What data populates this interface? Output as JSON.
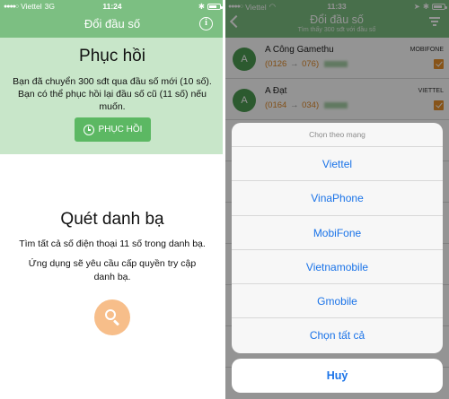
{
  "left": {
    "status": {
      "carrier": "Viettel",
      "network": "3G",
      "time": "11:24"
    },
    "header": {
      "title": "Đổi đầu số",
      "info_icon": "info-icon"
    },
    "restore": {
      "title": "Phục hồi",
      "description": "Bạn đã chuyển 300 sđt qua đầu số mới (10 số). Bạn có thể phục hồi lại đầu số cũ (11 số) nếu muốn.",
      "button_label": "PHỤC HỒI",
      "button_icon": "history-icon"
    },
    "scan": {
      "title": "Quét danh bạ",
      "desc1": "Tìm tất cả số điện thoại 11 số trong danh bạ.",
      "desc2": "Ứng dụng sẽ yêu cầu cấp quyền try cập danh bạ.",
      "button_icon": "search-icon"
    },
    "colors": {
      "header": "#7cbf82",
      "panel": "#c8e6c9",
      "button": "#5cb863",
      "scan_button": "#f7be8a"
    }
  },
  "right": {
    "status": {
      "carrier": "Viettel",
      "time": "11:33"
    },
    "header": {
      "title": "Đổi đầu số",
      "subtitle": "Tìm thấy 300 sđt với đầu số"
    },
    "contacts": [
      {
        "initial": "A",
        "name": "A Công Gamethu",
        "old_prefix": "(0126",
        "new_prefix": "076)",
        "network": "MOBIFONE",
        "checked": true
      },
      {
        "initial": "A",
        "name": "A Đạt",
        "old_prefix": "(0164",
        "new_prefix": "034)",
        "network": "VIETTEL",
        "checked": true
      }
    ],
    "sheet": {
      "title": "Chọn theo mạng",
      "options": [
        "Viettel",
        "VinaPhone",
        "MobiFone",
        "Vietnamobile",
        "Gmobile",
        "Chọn tất cả"
      ],
      "cancel": "Huỷ"
    },
    "colors": {
      "accent": "#1a73e8",
      "checkbox": "#e8912c",
      "avatar": "#4c9b52"
    }
  }
}
